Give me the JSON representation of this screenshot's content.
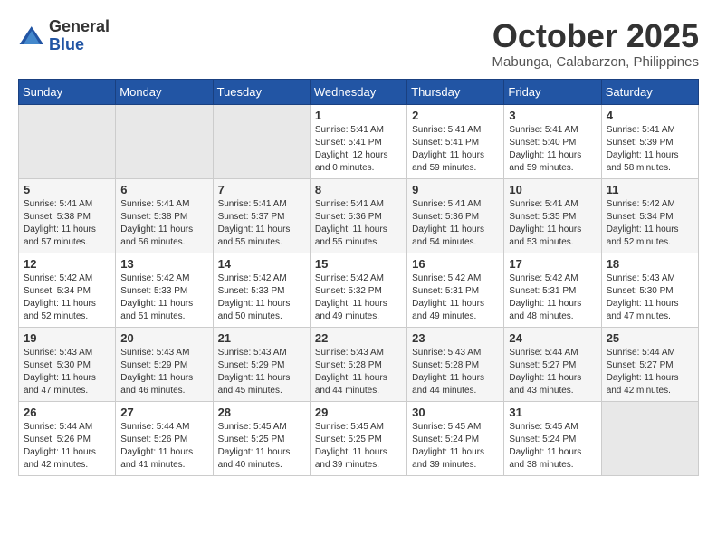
{
  "logo": {
    "general": "General",
    "blue": "Blue"
  },
  "title": "October 2025",
  "subtitle": "Mabunga, Calabarzon, Philippines",
  "weekdays": [
    "Sunday",
    "Monday",
    "Tuesday",
    "Wednesday",
    "Thursday",
    "Friday",
    "Saturday"
  ],
  "weeks": [
    [
      {
        "day": "",
        "empty": true
      },
      {
        "day": "",
        "empty": true
      },
      {
        "day": "",
        "empty": true
      },
      {
        "day": "1",
        "sunrise": "5:41 AM",
        "sunset": "5:41 PM",
        "daylight": "12 hours and 0 minutes."
      },
      {
        "day": "2",
        "sunrise": "5:41 AM",
        "sunset": "5:41 PM",
        "daylight": "11 hours and 59 minutes."
      },
      {
        "day": "3",
        "sunrise": "5:41 AM",
        "sunset": "5:40 PM",
        "daylight": "11 hours and 59 minutes."
      },
      {
        "day": "4",
        "sunrise": "5:41 AM",
        "sunset": "5:39 PM",
        "daylight": "11 hours and 58 minutes."
      }
    ],
    [
      {
        "day": "5",
        "sunrise": "5:41 AM",
        "sunset": "5:38 PM",
        "daylight": "11 hours and 57 minutes."
      },
      {
        "day": "6",
        "sunrise": "5:41 AM",
        "sunset": "5:38 PM",
        "daylight": "11 hours and 56 minutes."
      },
      {
        "day": "7",
        "sunrise": "5:41 AM",
        "sunset": "5:37 PM",
        "daylight": "11 hours and 55 minutes."
      },
      {
        "day": "8",
        "sunrise": "5:41 AM",
        "sunset": "5:36 PM",
        "daylight": "11 hours and 55 minutes."
      },
      {
        "day": "9",
        "sunrise": "5:41 AM",
        "sunset": "5:36 PM",
        "daylight": "11 hours and 54 minutes."
      },
      {
        "day": "10",
        "sunrise": "5:41 AM",
        "sunset": "5:35 PM",
        "daylight": "11 hours and 53 minutes."
      },
      {
        "day": "11",
        "sunrise": "5:42 AM",
        "sunset": "5:34 PM",
        "daylight": "11 hours and 52 minutes."
      }
    ],
    [
      {
        "day": "12",
        "sunrise": "5:42 AM",
        "sunset": "5:34 PM",
        "daylight": "11 hours and 52 minutes."
      },
      {
        "day": "13",
        "sunrise": "5:42 AM",
        "sunset": "5:33 PM",
        "daylight": "11 hours and 51 minutes."
      },
      {
        "day": "14",
        "sunrise": "5:42 AM",
        "sunset": "5:33 PM",
        "daylight": "11 hours and 50 minutes."
      },
      {
        "day": "15",
        "sunrise": "5:42 AM",
        "sunset": "5:32 PM",
        "daylight": "11 hours and 49 minutes."
      },
      {
        "day": "16",
        "sunrise": "5:42 AM",
        "sunset": "5:31 PM",
        "daylight": "11 hours and 49 minutes."
      },
      {
        "day": "17",
        "sunrise": "5:42 AM",
        "sunset": "5:31 PM",
        "daylight": "11 hours and 48 minutes."
      },
      {
        "day": "18",
        "sunrise": "5:43 AM",
        "sunset": "5:30 PM",
        "daylight": "11 hours and 47 minutes."
      }
    ],
    [
      {
        "day": "19",
        "sunrise": "5:43 AM",
        "sunset": "5:30 PM",
        "daylight": "11 hours and 47 minutes."
      },
      {
        "day": "20",
        "sunrise": "5:43 AM",
        "sunset": "5:29 PM",
        "daylight": "11 hours and 46 minutes."
      },
      {
        "day": "21",
        "sunrise": "5:43 AM",
        "sunset": "5:29 PM",
        "daylight": "11 hours and 45 minutes."
      },
      {
        "day": "22",
        "sunrise": "5:43 AM",
        "sunset": "5:28 PM",
        "daylight": "11 hours and 44 minutes."
      },
      {
        "day": "23",
        "sunrise": "5:43 AM",
        "sunset": "5:28 PM",
        "daylight": "11 hours and 44 minutes."
      },
      {
        "day": "24",
        "sunrise": "5:44 AM",
        "sunset": "5:27 PM",
        "daylight": "11 hours and 43 minutes."
      },
      {
        "day": "25",
        "sunrise": "5:44 AM",
        "sunset": "5:27 PM",
        "daylight": "11 hours and 42 minutes."
      }
    ],
    [
      {
        "day": "26",
        "sunrise": "5:44 AM",
        "sunset": "5:26 PM",
        "daylight": "11 hours and 42 minutes."
      },
      {
        "day": "27",
        "sunrise": "5:44 AM",
        "sunset": "5:26 PM",
        "daylight": "11 hours and 41 minutes."
      },
      {
        "day": "28",
        "sunrise": "5:45 AM",
        "sunset": "5:25 PM",
        "daylight": "11 hours and 40 minutes."
      },
      {
        "day": "29",
        "sunrise": "5:45 AM",
        "sunset": "5:25 PM",
        "daylight": "11 hours and 39 minutes."
      },
      {
        "day": "30",
        "sunrise": "5:45 AM",
        "sunset": "5:24 PM",
        "daylight": "11 hours and 39 minutes."
      },
      {
        "day": "31",
        "sunrise": "5:45 AM",
        "sunset": "5:24 PM",
        "daylight": "11 hours and 38 minutes."
      },
      {
        "day": "",
        "empty": true
      }
    ]
  ],
  "labels": {
    "sunrise": "Sunrise:",
    "sunset": "Sunset:",
    "daylight": "Daylight:"
  }
}
